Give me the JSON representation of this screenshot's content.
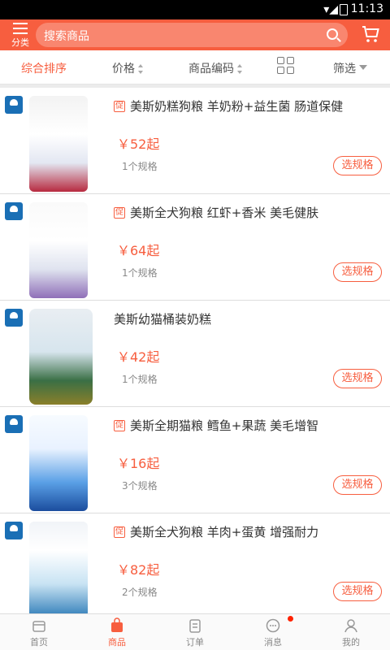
{
  "status": {
    "time": "11:13"
  },
  "header": {
    "category_label": "分类",
    "search_placeholder": "搜索商品"
  },
  "sort": {
    "comprehensive": "综合排序",
    "price": "价格",
    "code": "商品编码",
    "filter": "筛选"
  },
  "accent_color": "#f75e3f",
  "products": [
    {
      "promo": "促",
      "title": "美斯奶糕狗粮 羊奶粉+益生菌 肠道保健",
      "price": "￥52起",
      "specs": "1个规格",
      "button": "选规格",
      "has_promo": true
    },
    {
      "promo": "促",
      "title": "美斯全犬狗粮 红虾+香米 美毛健肤",
      "price": "￥64起",
      "specs": "1个规格",
      "button": "选规格",
      "has_promo": true
    },
    {
      "promo": "",
      "title": "美斯幼猫桶装奶糕",
      "price": "￥42起",
      "specs": "1个规格",
      "button": "选规格",
      "has_promo": false
    },
    {
      "promo": "促",
      "title": "美斯全期猫粮 鳕鱼+果蔬 美毛增智",
      "price": "￥16起",
      "specs": "3个规格",
      "button": "选规格",
      "has_promo": true
    },
    {
      "promo": "促",
      "title": "美斯全犬狗粮 羊肉+蛋黄 增强耐力",
      "price": "￥82起",
      "specs": "2个规格",
      "button": "选规格",
      "has_promo": true
    }
  ],
  "tabs": [
    {
      "label": "首页",
      "icon": "home-icon"
    },
    {
      "label": "商品",
      "icon": "bag-icon"
    },
    {
      "label": "订单",
      "icon": "order-icon"
    },
    {
      "label": "消息",
      "icon": "message-icon"
    },
    {
      "label": "我的",
      "icon": "user-icon"
    }
  ]
}
